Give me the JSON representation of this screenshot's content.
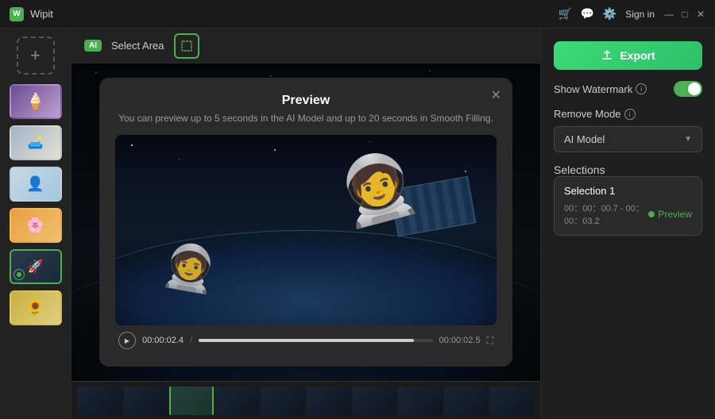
{
  "app": {
    "name": "Wipit",
    "icon_label": "W"
  },
  "title_bar": {
    "cart_icon": "🛒",
    "chat_icon": "💬",
    "settings_icon": "⚙️",
    "sign_in": "Sign in",
    "minimize": "—",
    "maximize": "□",
    "close": "✕"
  },
  "toolbar": {
    "ai_badge": "AI",
    "select_area_label": "Select Area",
    "select_icon": "⬛"
  },
  "export_btn": {
    "label": "Export",
    "icon": "↑"
  },
  "right_panel": {
    "watermark_label": "Show Watermark",
    "remove_mode_label": "Remove Mode",
    "remove_mode_value": "AI Model",
    "selections_label": "Selections",
    "selection_1": {
      "title": "Selection 1",
      "time_range": "00：00：00.7 - 00：00：03.2",
      "preview_label": "Preview"
    }
  },
  "modal": {
    "title": "Preview",
    "subtitle": "You can preview up to 5 seconds in the AI Model and up to 20 seconds in Smooth Filling.",
    "close_icon": "✕",
    "time_current": "00:00:02.4",
    "time_total": "00:00:02.5"
  },
  "thumbnails": [
    {
      "id": "thumb-1",
      "class": "thumb-1",
      "active": false
    },
    {
      "id": "thumb-2",
      "class": "thumb-2",
      "active": false
    },
    {
      "id": "thumb-3",
      "class": "thumb-3",
      "active": false
    },
    {
      "id": "thumb-4",
      "class": "thumb-4",
      "active": false
    },
    {
      "id": "thumb-5",
      "class": "thumb-5",
      "active": true
    },
    {
      "id": "thumb-6",
      "class": "thumb-6",
      "active": false
    }
  ],
  "add_button_label": "+",
  "info_icon_label": "ⓘ"
}
